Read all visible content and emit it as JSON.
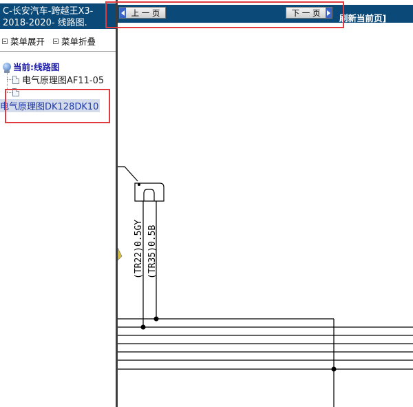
{
  "sidebar": {
    "title": "C-长安汽车-跨越王X3-2018-2020- 线路图.",
    "expand_label": "菜单展开",
    "collapse_label": "菜单折叠",
    "tree_root": "当前:线路图",
    "items": [
      {
        "label": "电气原理图AF11-05"
      },
      {
        "label": "电气原理图DK128DK10"
      }
    ]
  },
  "toolbar": {
    "prev_label": "上 一 页",
    "next_label": "下 一 页",
    "refresh_label": "刷新当前页]"
  },
  "diagram": {
    "wire_labels": [
      "(TR22)0.5GY",
      "(TR35)0.5B"
    ]
  },
  "colors": {
    "header_blue": "#0b4a78",
    "highlight_red": "#e0393e",
    "button_accent": "#3a64c8"
  }
}
